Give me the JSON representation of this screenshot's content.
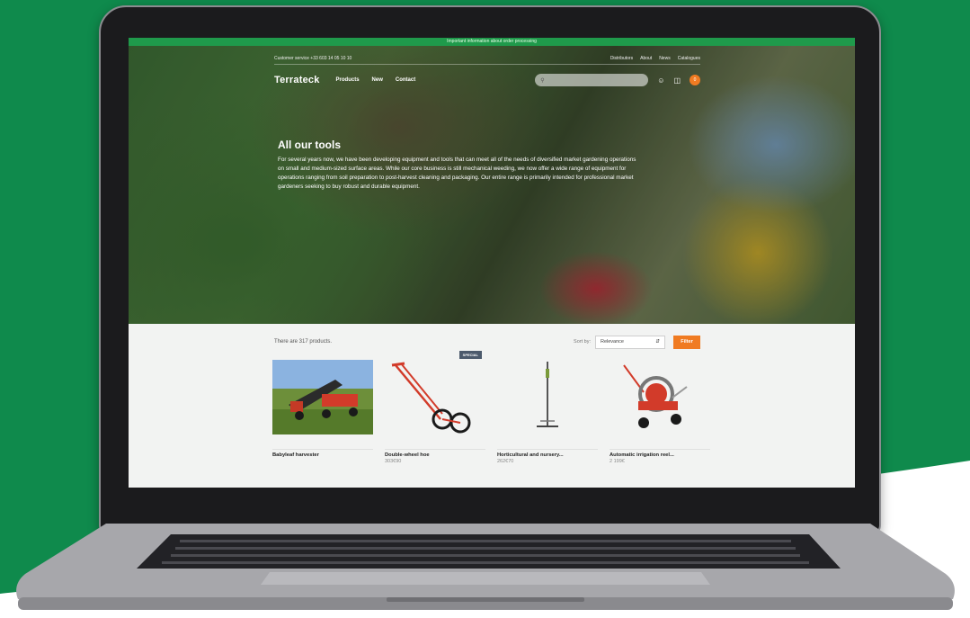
{
  "announcement": "Important information about order processing",
  "util_bar": {
    "customer_service": "Customer service +33 603 14 05 10 10",
    "links": [
      "Distributors",
      "About",
      "News",
      "Catalogues"
    ]
  },
  "nav": {
    "logo": "Terrateck",
    "menu": [
      "Products",
      "New",
      "Contact"
    ],
    "search_placeholder": "",
    "cart_count": "0"
  },
  "hero": {
    "title": "All our tools",
    "description": "For several years now, we have been developing equipment and tools that can meet all of the needs of diversified market gardening operations on small and medium-sized surface areas. While our core business is still mechanical weeding, we now offer a wide range of equipment for operations ranging from soil preparation to post-harvest cleaning and packaging. Our entire range is primarily intended for professional market gardeners seeking to buy robust and durable equipment."
  },
  "listing": {
    "count_text": "There are 317 products.",
    "sort_label": "Sort by:",
    "sort_value": "Relevance",
    "filter_label": "Filter"
  },
  "products": [
    {
      "name": "Babyleaf harvester",
      "price": "",
      "badge": ""
    },
    {
      "name": "Double-wheel hoe",
      "price": "303€90",
      "badge": "SPECIAL"
    },
    {
      "name": "Horticultural and nursery...",
      "price": "262€70",
      "badge": ""
    },
    {
      "name": "Automatic irrigation reel...",
      "price": "2 199€",
      "badge": ""
    }
  ],
  "colors": {
    "brand_green": "#1f9a4b",
    "accent_orange": "#f07b22",
    "background_green": "#0f8a4c"
  }
}
